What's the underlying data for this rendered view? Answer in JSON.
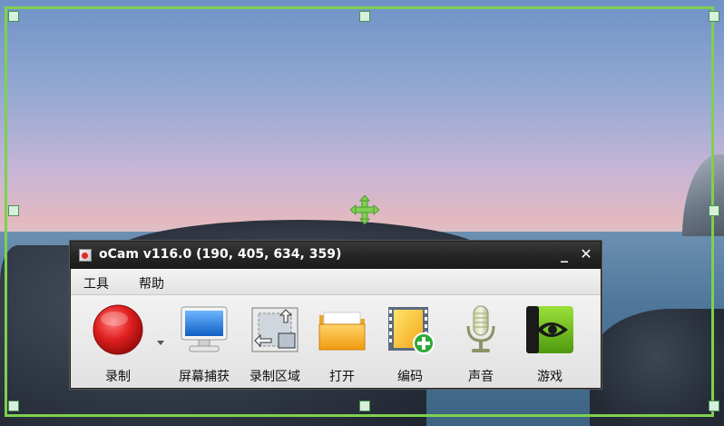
{
  "window": {
    "title": "oCam v116.0 (190, 405, 634, 359)",
    "minimize_label": "_",
    "close_label": "✕"
  },
  "menu": {
    "items": [
      {
        "label": "工具"
      },
      {
        "label": "帮助"
      }
    ]
  },
  "toolbar": {
    "tools": [
      {
        "label": "录制",
        "icon": "record-icon"
      },
      {
        "label": "屏幕捕获",
        "icon": "monitor-icon"
      },
      {
        "label": "录制区域",
        "icon": "resize-region-icon"
      },
      {
        "label": "打开",
        "icon": "folder-icon"
      },
      {
        "label": "编码",
        "icon": "film-add-icon"
      },
      {
        "label": "声音",
        "icon": "microphone-icon"
      },
      {
        "label": "游戏",
        "icon": "nvidia-icon"
      }
    ],
    "record_dropdown_icon": "chevron-down-icon"
  },
  "colors": {
    "selection_border": "#7fd04f",
    "move_handle": "#7fd04f",
    "record_red": "#e02020",
    "titlebar": "#262626"
  }
}
